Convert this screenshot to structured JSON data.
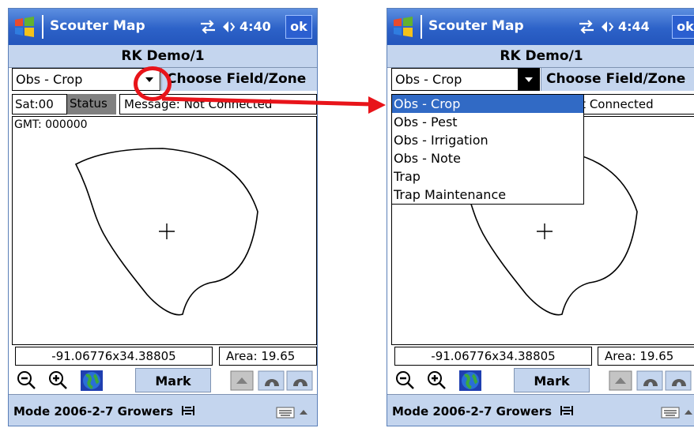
{
  "app": {
    "title": "Scouter Map",
    "ok_label": "ok",
    "document": "RK Demo/1"
  },
  "screens": [
    {
      "time": "4:40",
      "combo_value": "Obs - Crop",
      "choose_label": "Choose Field/Zone",
      "sat_label": "Sat:00",
      "status_label": "Status",
      "message": "Message: Not Connected",
      "gmt": "GMT: 000000",
      "coordinates": "-91.06776x34.38805",
      "area": "Area: 19.65",
      "mark_label": "Mark",
      "mode_text": "Mode 2006-2-7 Growers"
    },
    {
      "time": "4:44",
      "combo_value": "Obs - Crop",
      "choose_label": "Choose Field/Zone",
      "message_partial": "ot Connected",
      "coordinates": "-91.06776x34.38805",
      "area": "Area: 19.65",
      "mark_label": "Mark",
      "mode_text": "Mode 2006-2-7 Growers",
      "dropdown_options": [
        "Obs - Crop",
        "Obs - Pest",
        "Obs - Irrigation",
        "Obs - Note",
        "Trap",
        "Trap Maintenance"
      ],
      "selected_option": "Obs - Crop"
    }
  ],
  "colors": {
    "titlebar": "#2d62c8",
    "bar": "#c4d5ee",
    "highlight": "#316ac5",
    "annotation": "#e8141a"
  },
  "icons": [
    "windows-logo-icon",
    "connectivity-icon",
    "speaker-icon",
    "zoom-out-icon",
    "zoom-in-icon",
    "globe-icon",
    "scroll-icon",
    "undo-icon",
    "redo-icon",
    "signal-icon",
    "keyboard-icon",
    "chevron-up-icon"
  ]
}
